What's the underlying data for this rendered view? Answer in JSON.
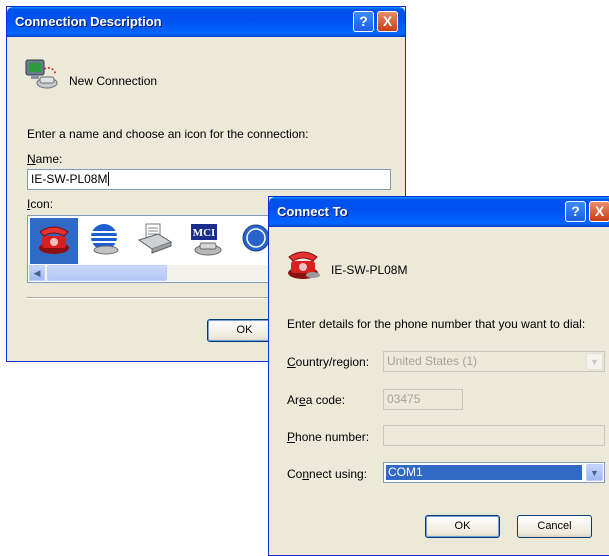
{
  "back_dialog": {
    "title": "Connection Description",
    "help_button": "?",
    "close_button": "X",
    "connection_name_display": "New Connection",
    "instructions": "Enter a name and choose an icon for the connection:",
    "name_label_accel": "N",
    "name_label_rest": "ame:",
    "name_value": "IE-SW-PL08M",
    "icon_label_accel": "I",
    "icon_label_rest": "con:",
    "icons": [
      "phone-icon",
      "globe-icon",
      "fax-icon",
      "mci-icon",
      "ge-icon"
    ],
    "mci_text": "MCI",
    "ok_label": "OK"
  },
  "front_dialog": {
    "title": "Connect To",
    "help_button": "?",
    "close_button": "X",
    "connection_name": "IE-SW-PL08M",
    "instructions": "Enter details for the phone number that you want to dial:",
    "country_label_accel": "C",
    "country_label_rest": "ountry/region:",
    "country_value": "United States (1)",
    "area_label_pre": "Ar",
    "area_label_accel": "e",
    "area_label_post": "a code:",
    "area_value": "03475",
    "phone_label_accel": "P",
    "phone_label_rest": "hone number:",
    "phone_value": "",
    "connect_label_pre": "Co",
    "connect_label_accel": "n",
    "connect_label_post": "nect using:",
    "connect_value": "COM1",
    "ok_label": "OK",
    "cancel_label": "Cancel"
  }
}
